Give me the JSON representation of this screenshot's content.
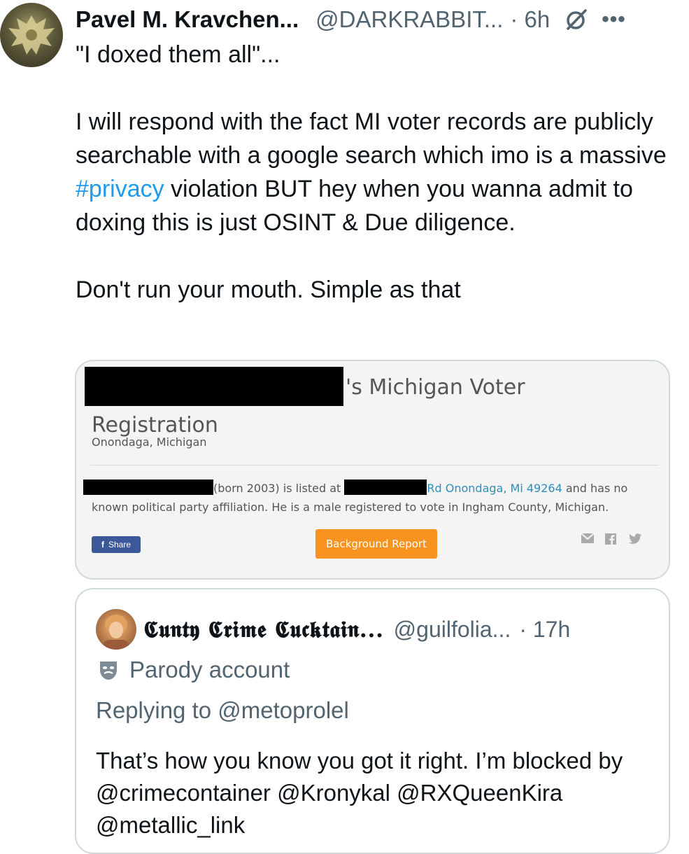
{
  "post": {
    "display_name": "Pavel M. Kravchen...",
    "handle": "@DARKRABBIT...",
    "time": "· 6h",
    "text_line1": "\"I doxed them all\"...",
    "text_para2_before": "I will respond with the fact MI voter records are publicly searchable with a google search which imo is a massive ",
    "hashtag": "#privacy",
    "text_para2_after": " violation BUT hey when you wanna admit to doxing this is just OSINT & Due diligence.",
    "text_para3": "Don't run your mouth. Simple as that"
  },
  "card": {
    "title_line1": "'s Michigan Voter",
    "title_line2": "Registration",
    "location": "Onondaga, Michigan",
    "info_born": "(born 2003) is listed at",
    "info_address": "Rd Onondaga, Mi 49264",
    "info_rest": " and has no known political party affiliation. He is a male registered to vote in Ingham County, Michigan.",
    "share_label": "Share",
    "background_report_label": "Background Report",
    "accent_color": "#f7931e",
    "facebook_color": "#3b5998"
  },
  "quote": {
    "display_name": "𝕮𝖚𝖓𝖙𝖞 𝕮𝖗𝖎𝖒𝖊 𝕮𝖚𝖈𝖐𝖙𝖆𝖎𝖓...",
    "handle": "@guilfolia...",
    "time": "· 17h",
    "parody_label": "Parody account",
    "replying_to": "Replying to @metoprolel",
    "text": "That’s how you know you got it right. I’m blocked by @crimecontainer @Kronykal @RXQueenKira @metallic_link"
  },
  "icons": {
    "grok": "grok-icon",
    "more": "more-icon",
    "mask": "parody-mask-icon"
  }
}
